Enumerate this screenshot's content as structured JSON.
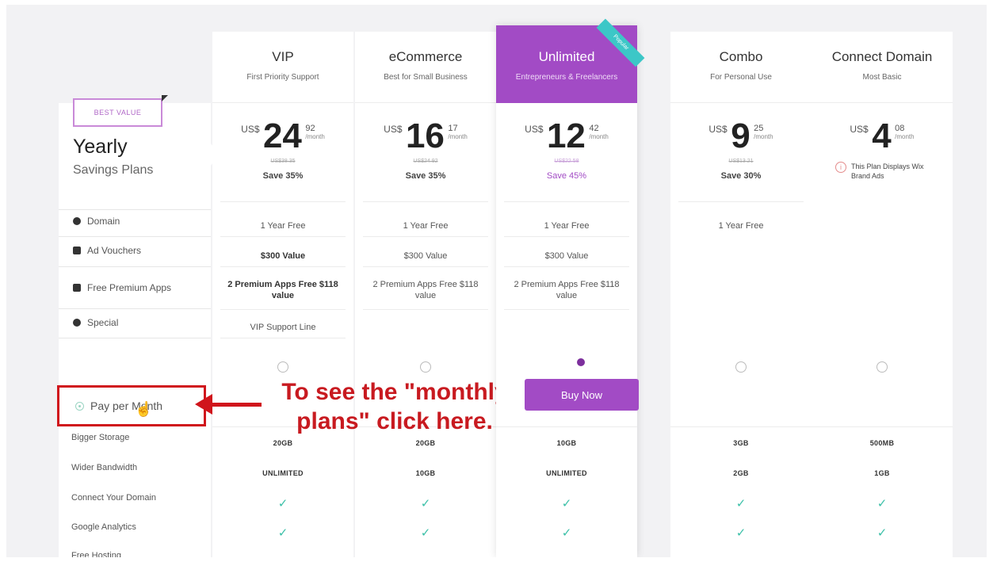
{
  "left": {
    "badge": "BEST VALUE",
    "title": "Yearly",
    "subtitle": "Savings Plans",
    "features": [
      {
        "label": "Domain",
        "icon": "globe-icon"
      },
      {
        "label": "Ad Vouchers",
        "icon": "voucher-icon"
      },
      {
        "label": "Free Premium Apps",
        "icon": "apps-icon"
      },
      {
        "label": "Special",
        "icon": "chat-icon"
      }
    ],
    "pay_monthly": "Pay per Month",
    "rows": [
      "Bigger Storage",
      "Wider Bandwidth",
      "Connect Your Domain",
      "Google Analytics",
      "Free Hosting"
    ]
  },
  "annotation": {
    "line1": "To see the \"monthly",
    "line2": "plans\" click here."
  },
  "colors": {
    "accent": "#a24bc5",
    "annotation": "#c81a20",
    "check": "#3cc0a8"
  },
  "plans": [
    {
      "name": "VIP",
      "desc": "First Priority Support",
      "currency": "US$",
      "price": "24",
      "cents": "92",
      "per": "/month",
      "original": "US$38.35",
      "save": "Save 35%",
      "domain": "1 Year Free",
      "vouchers": "$300 Value",
      "apps": "2 Premium Apps Free $118 value",
      "special": "VIP Support Line",
      "storage": "20GB",
      "bandwidth": "UNLIMITED"
    },
    {
      "name": "eCommerce",
      "desc": "Best for Small Business",
      "currency": "US$",
      "price": "16",
      "cents": "17",
      "per": "/month",
      "original": "US$24.92",
      "save": "Save 35%",
      "domain": "1 Year Free",
      "vouchers": "$300 Value",
      "apps": "2 Premium Apps Free $118 value",
      "special": "",
      "storage": "20GB",
      "bandwidth": "10GB"
    },
    {
      "name": "Unlimited",
      "desc": "Entrepreneurs & Freelancers",
      "ribbon": "Popular",
      "currency": "US$",
      "price": "12",
      "cents": "42",
      "per": "/month",
      "original": "US$22.58",
      "save": "Save 45%",
      "domain": "1 Year Free",
      "vouchers": "$300 Value",
      "apps": "2 Premium Apps Free $118 value",
      "special": "",
      "buy": "Buy Now",
      "storage": "10GB",
      "bandwidth": "UNLIMITED"
    },
    {
      "name": "Combo",
      "desc": "For Personal Use",
      "currency": "US$",
      "price": "9",
      "cents": "25",
      "per": "/month",
      "original": "US$13.21",
      "save": "Save 30%",
      "domain": "1 Year Free",
      "vouchers": "",
      "apps": "",
      "special": "",
      "storage": "3GB",
      "bandwidth": "2GB"
    },
    {
      "name": "Connect Domain",
      "desc": "Most Basic",
      "currency": "US$",
      "price": "4",
      "cents": "08",
      "per": "/month",
      "note": "This Plan Displays Wix Brand Ads",
      "storage": "500MB",
      "bandwidth": "1GB"
    }
  ]
}
